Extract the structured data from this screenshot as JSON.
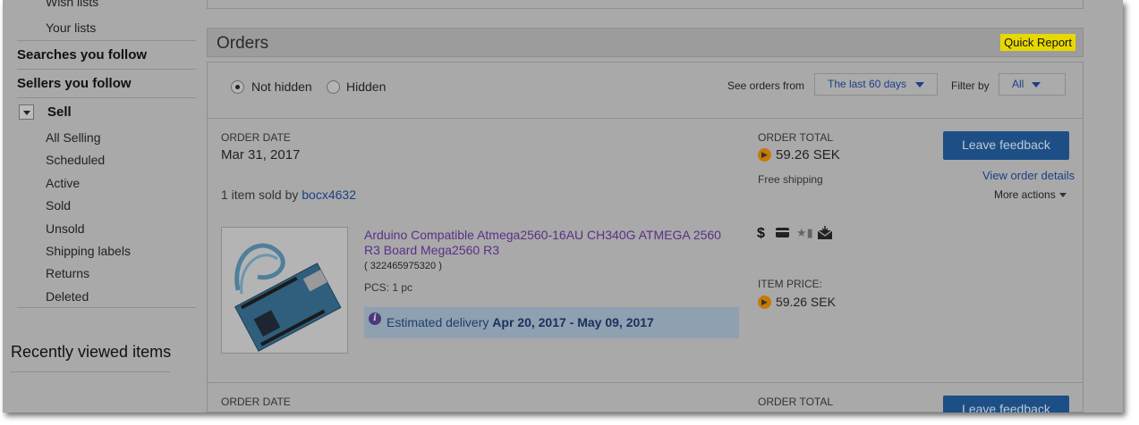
{
  "sidebar": {
    "wish_lists_cut": "Wish lists",
    "your_lists": "Your lists",
    "searches_follow": "Searches you follow",
    "sellers_follow": "Sellers you follow",
    "sell": "Sell",
    "sell_items": [
      "All Selling",
      "Scheduled",
      "Active",
      "Sold",
      "Unsold",
      "Shipping labels",
      "Returns",
      "Deleted"
    ],
    "recently_viewed": "Recently viewed items"
  },
  "orders": {
    "title": "Orders",
    "quick_report": "Quick Report",
    "filter": {
      "not_hidden": "Not hidden",
      "hidden": "Hidden",
      "selected": "Not hidden",
      "see_orders_from_label": "See orders from",
      "see_orders_from_value": "The last 60 days",
      "filter_by_label": "Filter by",
      "filter_by_value": "All"
    },
    "order1": {
      "order_date_label": "ORDER DATE",
      "order_date": "Mar 31, 2017",
      "order_total_label": "ORDER TOTAL",
      "order_total": "59.26 SEK",
      "shipping": "Free shipping",
      "sold_by_prefix": "1 item sold by",
      "seller": "bocx4632",
      "leave_feedback": "Leave feedback",
      "view_order_details": "View order details",
      "more_actions": "More actions",
      "item_title": "Arduino Compatible Atmega2560-16AU CH340G ATMEGA 2560 R3 Board Mega2560 R3",
      "item_number": "( 322465975320 )",
      "pcs": "PCS: 1 pc",
      "delivery_prefix": "Estimated delivery",
      "delivery_dates": "Apr 20, 2017 - May 09, 2017",
      "item_price_label": "ITEM PRICE:",
      "item_price": "59.26 SEK",
      "status_icons": [
        "dollar-icon",
        "payment-card-icon",
        "star-feedback-icon",
        "shipped-envelope-icon"
      ]
    },
    "order2": {
      "order_date_label": "ORDER DATE",
      "order_total_label": "ORDER TOTAL",
      "leave_feedback": "Leave feedback"
    }
  },
  "colors": {
    "background_dimmed": "#a9a9a9",
    "quick_report_highlight": "#e8d800",
    "button": "#1d4f86",
    "link": "#1b3f85",
    "item_title": "#5a2f88"
  }
}
